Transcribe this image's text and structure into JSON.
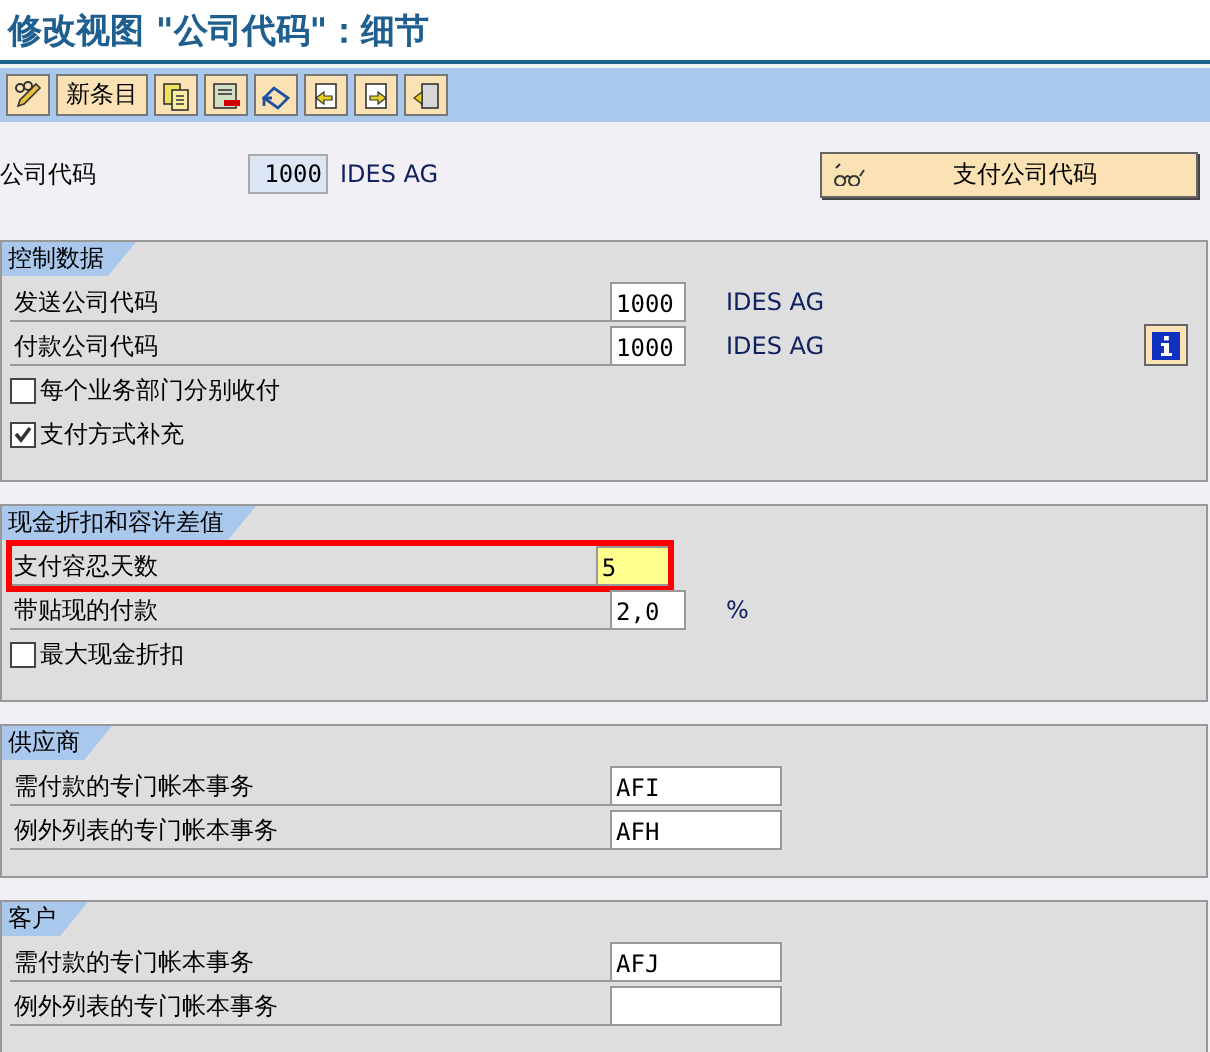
{
  "window": {
    "title": "修改视图 \"公司代码\"：细节"
  },
  "toolbar": [
    {
      "kind": "edit"
    },
    {
      "kind": "text",
      "label": "新条目"
    },
    {
      "kind": "copy"
    },
    {
      "kind": "delete"
    },
    {
      "kind": "undo"
    },
    {
      "kind": "previous"
    },
    {
      "kind": "next"
    },
    {
      "kind": "select"
    }
  ],
  "header": {
    "label": "公司代码",
    "value": "1000",
    "description": "IDES AG",
    "button": "支付公司代码"
  },
  "sections": [
    {
      "title": "控制数据",
      "kind": "main",
      "rows": [
        {
          "kind": "field",
          "label": "发送公司代码",
          "value": "1000",
          "suffix": "IDES AG",
          "highlighted": false,
          "info": false
        },
        {
          "kind": "field",
          "label": "付款公司代码",
          "value": "1000",
          "suffix": "IDES AG",
          "highlighted": false,
          "info": true
        },
        {
          "kind": "checkbox",
          "label": "每个业务部门分别收付",
          "checked": false
        },
        {
          "kind": "checkbox",
          "label": "支付方式补充",
          "checked": true
        }
      ]
    },
    {
      "title": "现金折扣和容许差值",
      "kind": "main",
      "rows": [
        {
          "kind": "field",
          "label": "支付容忍天数",
          "value": "5",
          "highlighted": true,
          "info": false
        },
        {
          "kind": "field",
          "label": "带贴现的付款",
          "value": "2,0",
          "suffix": "%",
          "highlighted": false,
          "info": false
        },
        {
          "kind": "checkbox",
          "label": "最大现金折扣",
          "checked": false
        }
      ]
    },
    {
      "title": "供应商",
      "kind": "accounts",
      "rows": [
        {
          "kind": "field",
          "label": "需付款的专门帐本事务",
          "value": "AFI",
          "highlighted": false,
          "info": false
        },
        {
          "kind": "field",
          "label": "例外列表的专门帐本事务",
          "value": "AFH",
          "highlighted": false,
          "info": false
        }
      ]
    },
    {
      "title": "客户",
      "kind": "accounts",
      "rows": [
        {
          "kind": "field",
          "label": "需付款的专门帐本事务",
          "value": "AFJ",
          "highlighted": false,
          "info": false
        },
        {
          "kind": "field",
          "label": "例外列表的专门帐本事务",
          "highlighted": false,
          "info": false
        }
      ]
    }
  ]
}
